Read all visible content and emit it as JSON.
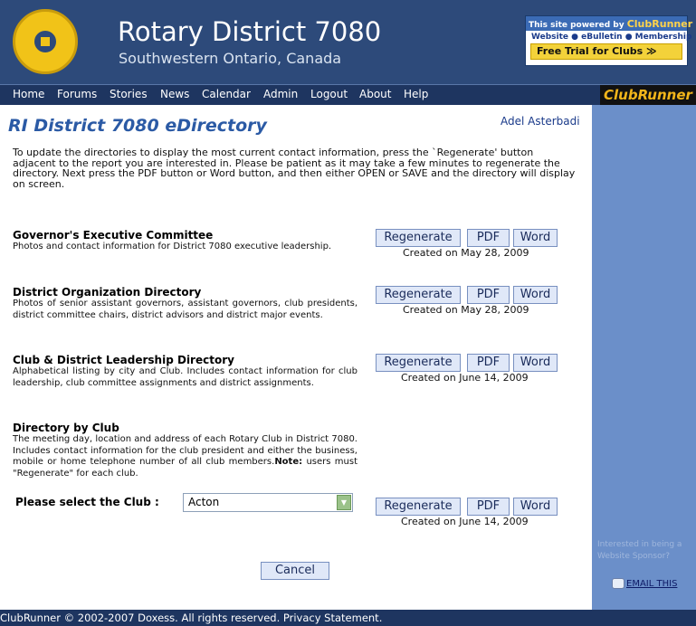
{
  "header": {
    "title": "Rotary District 7080",
    "subtitle": "Southwestern Ontario, Canada",
    "ad_powered": "This site powered by",
    "ad_brand": "ClubRunner",
    "ad_features": "Website ● eBulletin ● Membership",
    "ad_cta": "Free Trial for Clubs ≫"
  },
  "nav": {
    "items": [
      "Home",
      "Forums",
      "Stories",
      "News",
      "Calendar",
      "Admin",
      "Logout",
      "About",
      "Help"
    ],
    "brand": "ClubRunner"
  },
  "page": {
    "title": "RI District 7080 eDirectory",
    "user": "Adel Asterbadi",
    "intro": "To update the directories to display the most current contact information, press the `Regenerate' button adjacent to the report you are interested in. Please be patient as it may take a few minutes to regenerate the directory. Next press the PDF button or Word button, and then either OPEN or SAVE and the directory will display on screen."
  },
  "buttons": {
    "regenerate": "Regenerate",
    "pdf": "PDF",
    "word": "Word",
    "cancel": "Cancel"
  },
  "sections": [
    {
      "title": "Governor's Executive Committee",
      "desc": "Photos and contact information for District 7080 executive leadership.",
      "created": "Created on May 28, 2009"
    },
    {
      "title": "District Organization Directory",
      "desc": "Photos of senior assistant governors, assistant governors, club presidents, district committee chairs, district advisors and district major events.",
      "created": "Created on May 28, 2009"
    },
    {
      "title": "Club & District Leadership Directory",
      "desc": "Alphabetical listing by city and Club. Includes contact information for club leadership, club committee assignments and district assignments.",
      "created": "Created on June 14, 2009"
    },
    {
      "title": "Directory by Club",
      "desc": "The meeting day, location and address of each Rotary Club in District 7080. Includes contact information for the club president and either the business, mobile or home telephone number of all club members.",
      "note_label": "Note:",
      "note": " users must \"Regenerate\" for each club.",
      "created": "Created on June 14, 2009"
    }
  ],
  "club_select": {
    "label": "Please select the Club :",
    "value": "Acton"
  },
  "sidebar": {
    "sponsor": "Interested in being a Website Sponsor?",
    "email": "EMAIL THIS"
  },
  "footer": {
    "text": "ClubRunner © 2002-2007 Doxess. All rights reserved. Privacy Statement."
  }
}
